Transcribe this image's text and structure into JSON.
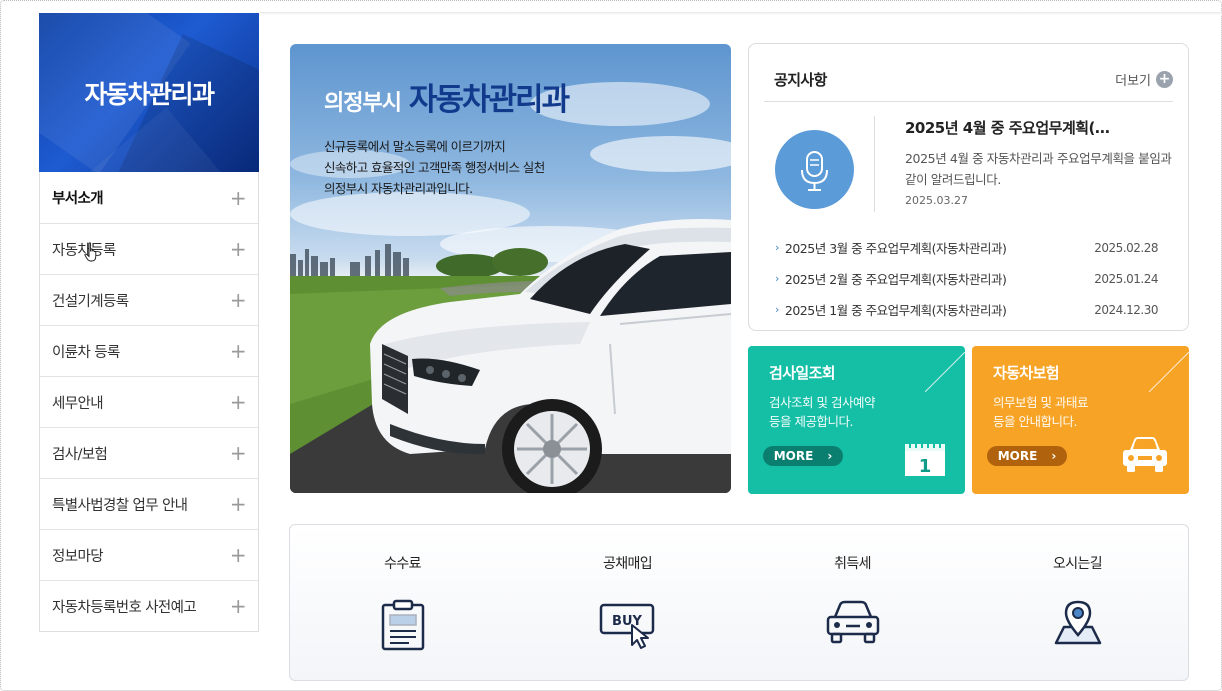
{
  "sidebar": {
    "title": "자동차관리과",
    "items": [
      {
        "label": "부서소개"
      },
      {
        "label": "자동차등록"
      },
      {
        "label": "건설기계등록"
      },
      {
        "label": "이륜차 등록"
      },
      {
        "label": "세무안내"
      },
      {
        "label": "검사/보험"
      },
      {
        "label": "특별사법경찰 업무 안내"
      },
      {
        "label": "정보마당"
      },
      {
        "label": "자동차등록번호 사전예고"
      }
    ],
    "plus": "+"
  },
  "hero": {
    "title_small": "의정부시",
    "title_large": "자동차관리과",
    "lines": [
      "신규등록에서 말소등록에 이르기까지",
      "신속하고 효율적인 고객만족 행정서비스 실천",
      "의정부시 자동차관리과입니다."
    ]
  },
  "notice": {
    "title": "공지사항",
    "more_label": "더보기",
    "featured": {
      "title": "2025년 4월 중 주요업무계획(…",
      "desc": "2025년 4월 중 자동차관리과 주요업무계획을 붙임과 같이 알려드립니다.",
      "date": "2025.03.27"
    },
    "list": [
      {
        "title": "2025년 3월 중 주요업무계획(자동차관리과)",
        "date": "2025.02.28"
      },
      {
        "title": "2025년 2월 중 주요업무계획(자동차관리과)",
        "date": "2025.01.24"
      },
      {
        "title": "2025년 1월 중 주요업무계획(자동차관리과)",
        "date": "2024.12.30"
      }
    ]
  },
  "cards": {
    "inspection": {
      "title": "검사일조회",
      "desc1": "검사조회 및 검사예약",
      "desc2": "등을 제공합니다.",
      "more": "MORE",
      "calendar_day": "1",
      "color": "#14bfa6"
    },
    "insurance": {
      "title": "자동차보험",
      "desc1": "의무보험 및 과태료",
      "desc2": "등을 안내합니다.",
      "more": "MORE",
      "color": "#f7a325"
    }
  },
  "quick": {
    "items": [
      {
        "label": "수수료",
        "icon": "clipboard-icon"
      },
      {
        "label": "공채매입",
        "icon": "buy-icon",
        "icon_text": "BUY"
      },
      {
        "label": "취득세",
        "icon": "car-icon"
      },
      {
        "label": "오시는길",
        "icon": "map-pin-icon"
      }
    ]
  },
  "colors": {
    "primary_blue": "#123a8c",
    "sidebar_blue": "#1e5bd1",
    "accent_link": "#4a86c8"
  }
}
